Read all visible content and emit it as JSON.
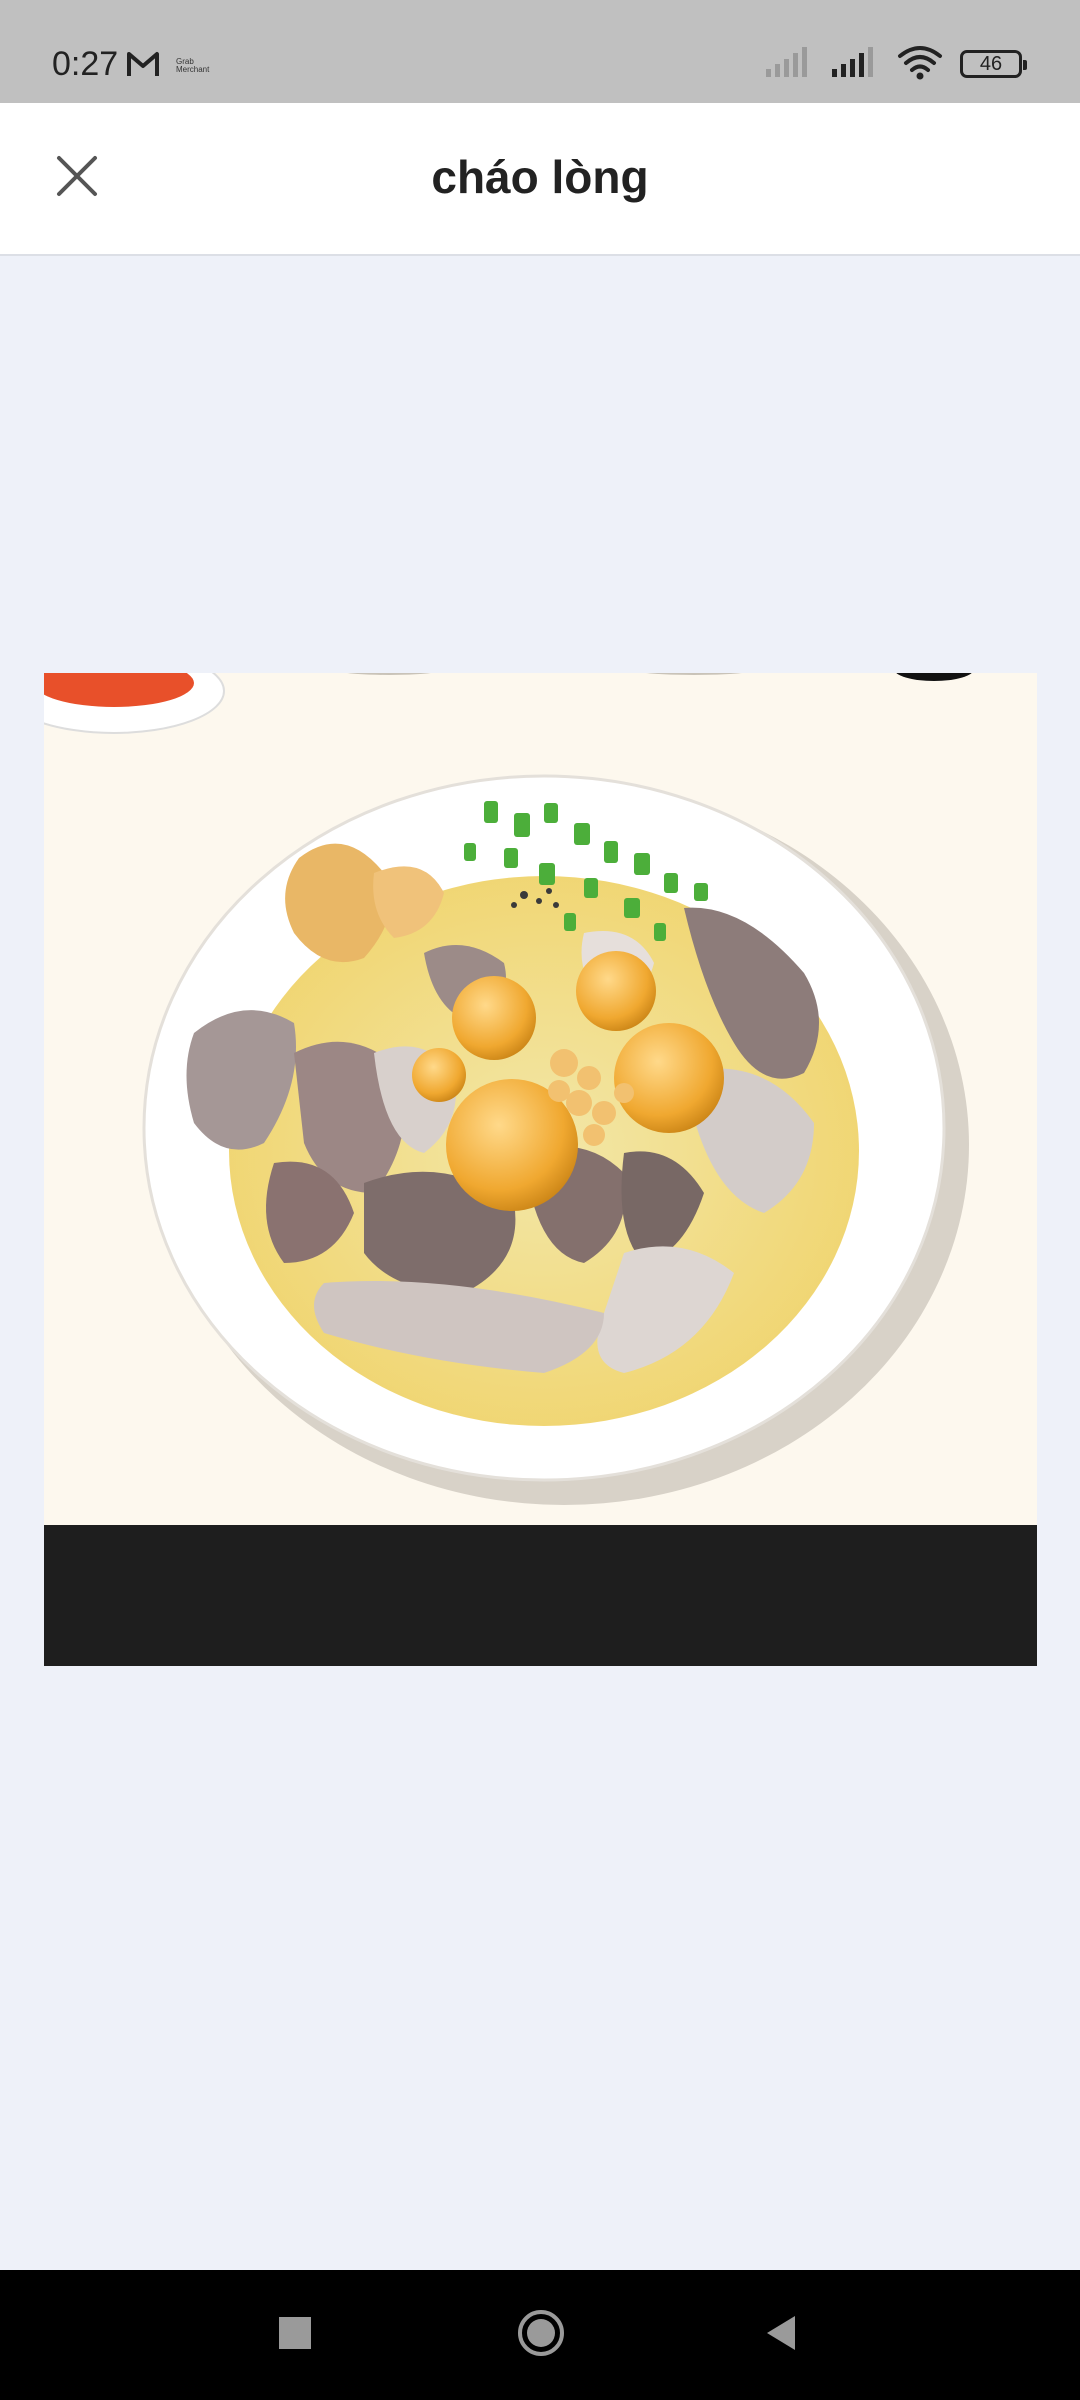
{
  "status_bar": {
    "time": "0:27",
    "grab_label": "Grab Merchant",
    "battery": "46",
    "icons": [
      "gmail-icon",
      "signal-icon",
      "signal-icon",
      "wifi-icon",
      "battery-icon"
    ]
  },
  "header": {
    "title": "cháo lòng",
    "close_icon": "close-icon"
  },
  "image": {
    "alt": "cháo lòng"
  },
  "nav": {
    "icons": [
      "recents-icon",
      "home-icon",
      "back-icon"
    ]
  },
  "colors": {
    "status_bar_bg": "#c0c0c0",
    "header_bg": "#ffffff",
    "viewer_bg": "#eef1f9",
    "nav_bg": "#000000"
  }
}
